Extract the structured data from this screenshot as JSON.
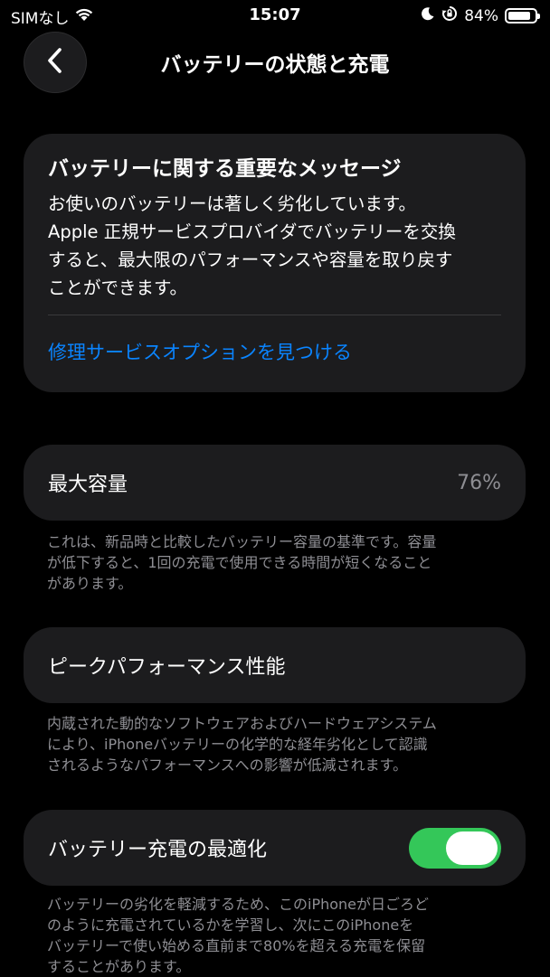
{
  "status_bar": {
    "carrier": "SIMなし",
    "time": "15:07",
    "battery_percent_label": "84%",
    "battery_level": 0.84
  },
  "nav": {
    "title": "バッテリーの状態と充電",
    "back_icon": "chevron-left-icon"
  },
  "message_card": {
    "title": "バッテリーに関する重要なメッセージ",
    "body": "お使いのバッテリーは著しく劣化しています。\nApple 正規サービスプロバイダでバッテリーを交換\nすると、最大限のパフォーマンスや容量を取り戻す\nことができます。",
    "link_label": "修理サービスオプションを見つける",
    "link_color": "#0a84ff"
  },
  "max_capacity": {
    "label": "最大容量",
    "value": "76%",
    "footnote": "これは、新品時と比較したバッテリー容量の基準です。容量\nが低下すると、1回の充電で使用できる時間が短くなること\nがあります。"
  },
  "peak_performance": {
    "label": "ピークパフォーマンス性能",
    "footnote": "内蔵された動的なソフトウェアおよびハードウェアシステム\nにより、iPhoneバッテリーの化学的な経年劣化として認識\nされるようなパフォーマンスへの影響が低減されます。"
  },
  "optimized_charging": {
    "label": "バッテリー充電の最適化",
    "enabled": true,
    "toggle_color": "#34c759",
    "footnote": "バッテリーの劣化を軽減するため、このiPhoneが日ごろど\nのように充電されているかを学習し、次にこのiPhoneを\nバッテリーで使い始める直前まで80%を超える充電を保留\nすることがあります。"
  }
}
